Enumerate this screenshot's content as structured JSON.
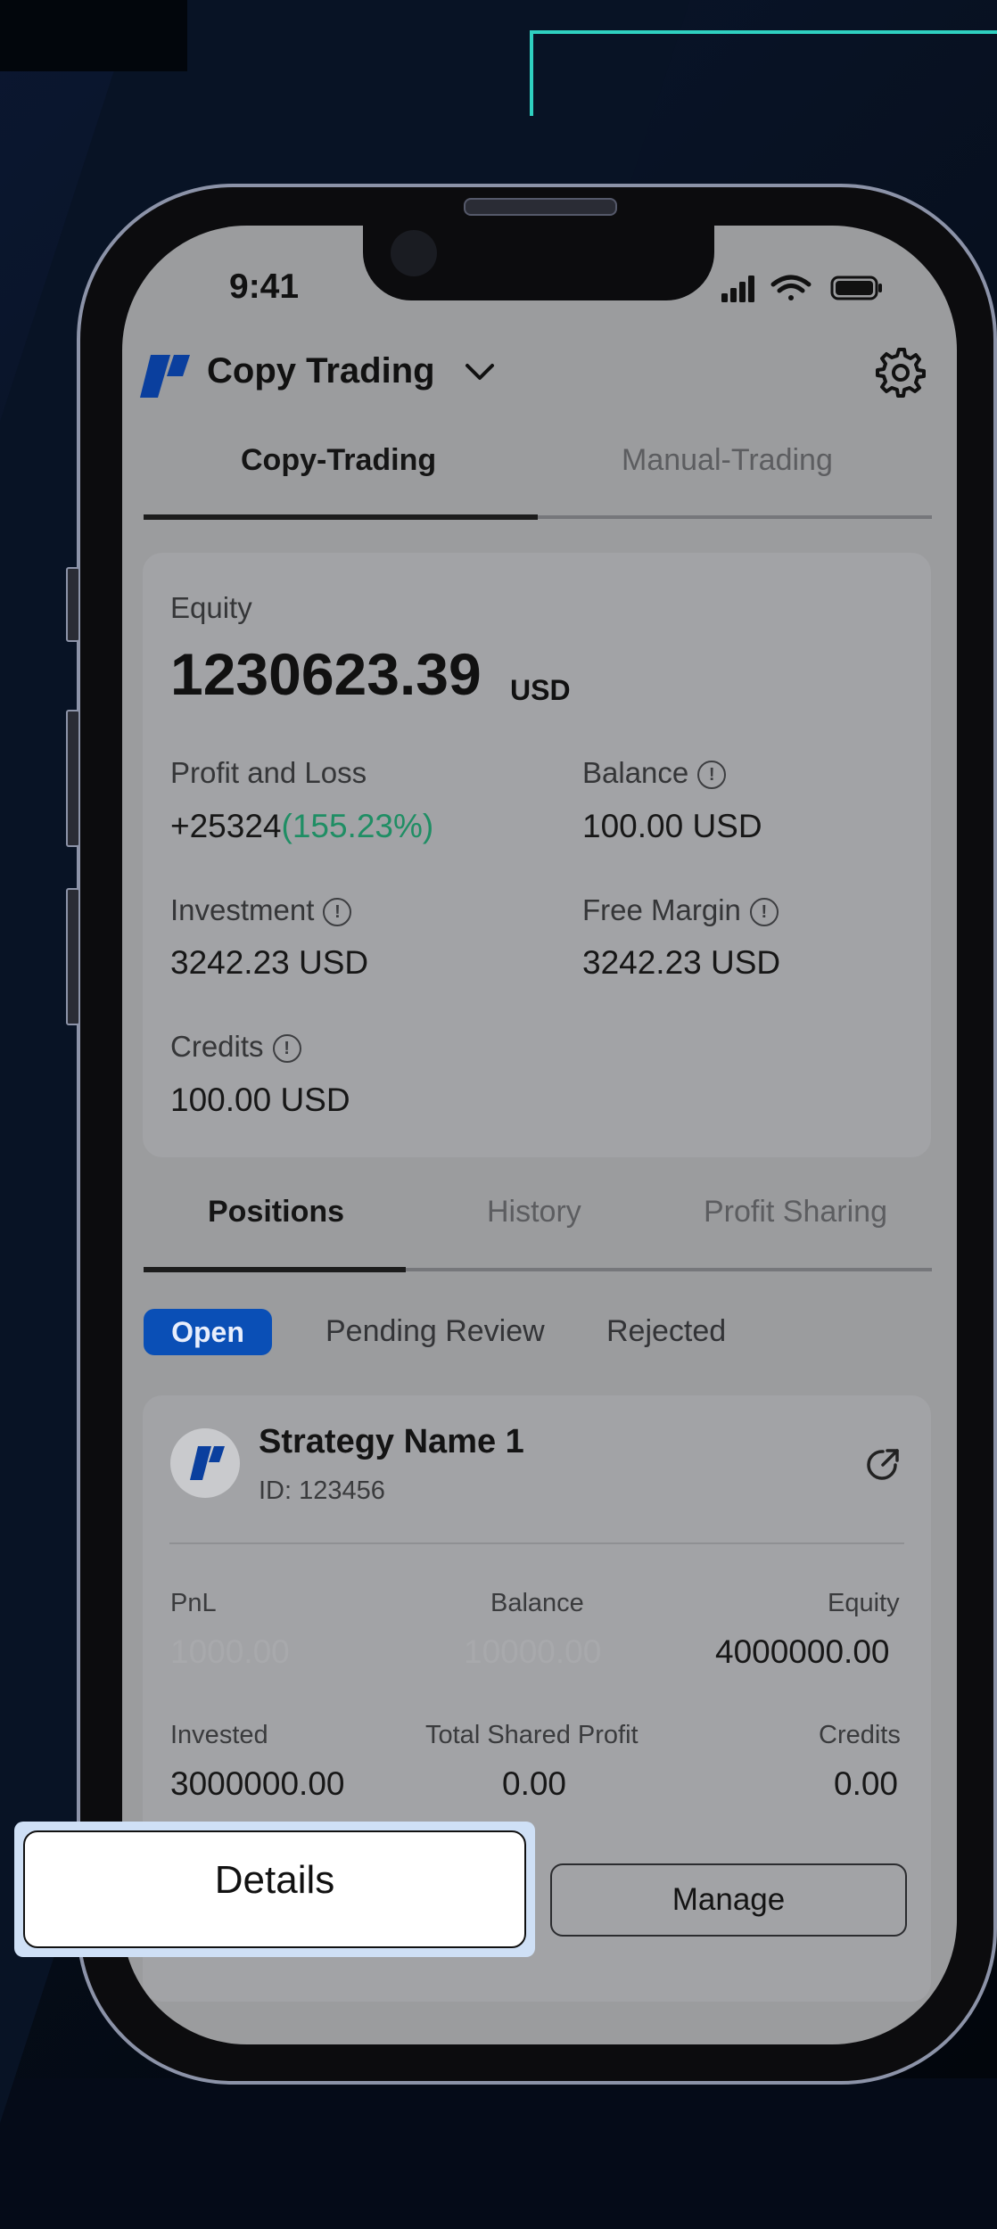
{
  "status_bar": {
    "time": "9:41"
  },
  "header": {
    "title": "Copy Trading"
  },
  "main_tabs": [
    {
      "label": "Copy-Trading"
    },
    {
      "label": "Manual-Trading"
    }
  ],
  "account": {
    "equity_label": "Equity",
    "equity_value": "1230623.39",
    "equity_unit": "USD",
    "pnl_label": "Profit and Loss",
    "pnl_value": "+25324",
    "pnl_percent": "(155.23%)",
    "balance_label": "Balance",
    "balance_value": "100.00 USD",
    "investment_label": "Investment",
    "investment_value": "3242.23 USD",
    "free_margin_label": "Free Margin",
    "free_margin_value": "3242.23 USD",
    "credits_label": "Credits",
    "credits_value": "100.00 USD"
  },
  "sub_tabs": [
    {
      "label": "Positions"
    },
    {
      "label": "History"
    },
    {
      "label": "Profit Sharing"
    }
  ],
  "filters": [
    {
      "label": "Open"
    },
    {
      "label": "Pending Review"
    },
    {
      "label": "Rejected"
    }
  ],
  "strategy": {
    "name": "Strategy Name 1",
    "id": "ID: 123456",
    "pnl_label": "PnL",
    "pnl_value": "1000.00",
    "balance_label": "Balance",
    "balance_value": "10000.00",
    "equity_label": "Equity",
    "equity_value": "4000000.00",
    "invested_label": "Invested",
    "invested_value": "3000000.00",
    "shared_label": "Total Shared Profit",
    "shared_value": "0.00",
    "credits_label": "Credits",
    "credits_value": "0.00"
  },
  "actions": {
    "details_label": "Details",
    "manage_label": "Manage"
  },
  "colors": {
    "accent_blue": "#0a4fb6",
    "positive_green": "#1f8e64",
    "teal_line": "#2fd0c0"
  },
  "icons": [
    "app-logo-icon",
    "chevron-down-icon",
    "gear-icon",
    "info-icon",
    "external-link-icon",
    "signal-icon",
    "wifi-icon",
    "battery-icon"
  ]
}
